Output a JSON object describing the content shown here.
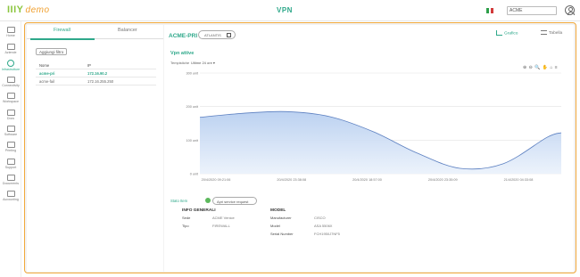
{
  "app": {
    "logo": "IIIY",
    "logo_suffix": "demo",
    "title": "VPN",
    "account": "ACME"
  },
  "sidebar": {
    "items": [
      {
        "label": "Home"
      },
      {
        "label": "Aziende"
      },
      {
        "label": "Infrastrutture"
      },
      {
        "label": "Connectivity"
      },
      {
        "label": "Workspace"
      },
      {
        "label": "Docs"
      },
      {
        "label": "Software"
      },
      {
        "label": "Printing"
      },
      {
        "label": "Support"
      },
      {
        "label": "Documents"
      },
      {
        "label": "Accounting"
      }
    ]
  },
  "left": {
    "tabs": [
      "Firewall",
      "Balancer"
    ],
    "add_button": "Aggiungi filtro",
    "columns": [
      "Nome",
      "IP"
    ],
    "rows": [
      {
        "name": "acme-pri",
        "ip": "172.16.90.2"
      },
      {
        "name": "acme-fail",
        "ip": "172.16.255.250"
      }
    ]
  },
  "detail": {
    "name": "ACME-PRI",
    "site": "ATLANTIS",
    "views": [
      "Grafico",
      "Tabella"
    ]
  },
  "chart_data": {
    "type": "area",
    "title": "Vpn attive",
    "time_label": "Tempistiche",
    "time_range": "Ultime 24 ore",
    "toolbar": "⊕ ⊖ 🔍 ✋ ⌂ ≡",
    "x_ticks": [
      "20/4/2020 09:21:06",
      "20/4/2020 23:38:08",
      "20/4/2020 18:57:00",
      "20/4/2020 23:35:09",
      "21/4/2020 04:33:08"
    ],
    "y_ticks": [
      "300 unit",
      "200 unit",
      "100 unit",
      "0 unit"
    ],
    "ylim": [
      0,
      300
    ],
    "series": [
      {
        "x": [
          0,
          0.12,
          0.24,
          0.36,
          0.48,
          0.6,
          0.72,
          0.84,
          0.96,
          1.0
        ],
        "values": [
          168,
          180,
          185,
          170,
          125,
          62,
          16,
          30,
          108,
          122
        ]
      }
    ],
    "fill_color": "#b8cff0",
    "line_color": "#5b7fc0"
  },
  "status": {
    "label": "Stato Item",
    "button": "Apri service request"
  },
  "info": {
    "general_title": "INFO GENERALI",
    "general": [
      {
        "k": "Sede",
        "v": "ACME Venice"
      },
      {
        "k": "Tipo",
        "v": "FIREWALL"
      }
    ],
    "model_title": "MODEL",
    "model": [
      {
        "k": "Manufacturer",
        "v": "CISCO"
      },
      {
        "k": "Model",
        "v": "ASA 5506X"
      },
      {
        "k": "Serial Number",
        "v": "FCH1950J7NF5"
      }
    ]
  }
}
